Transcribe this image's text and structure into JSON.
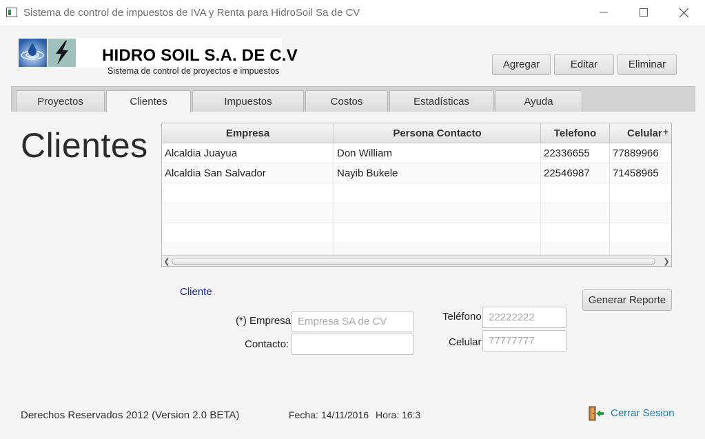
{
  "window": {
    "title": "Sistema de control de impuestos de IVA y Renta para HidroSoil Sa de CV",
    "minimize_icon": "minimize-icon",
    "maximize_icon": "maximize-icon",
    "close_icon": "close-icon"
  },
  "header": {
    "company_name": "HIDRO SOIL S.A. DE C.V",
    "subtitle": "Sistema de control de proyectos e impuestos",
    "actions": {
      "add_label": "Agregar",
      "edit_label": "Editar",
      "delete_label": "Eliminar"
    }
  },
  "tabs": [
    {
      "label": "Proyectos"
    },
    {
      "label": "Clientes"
    },
    {
      "label": "Impuestos"
    },
    {
      "label": "Costos"
    },
    {
      "label": "Estadísticas"
    },
    {
      "label": "Ayuda"
    }
  ],
  "active_tab": "Clientes",
  "page_title": "Clientes",
  "table": {
    "columns": [
      "Empresa",
      "Persona Contacto",
      "Telefono",
      "Celular"
    ],
    "rows": [
      [
        "Alcaldia Juayua",
        "Don William",
        "22336655",
        "77889966"
      ],
      [
        "Alcaldia San Salvador",
        "Nayib Bukele",
        "22546987",
        "71458965"
      ]
    ],
    "column_menu_icon": "plus-icon"
  },
  "form": {
    "section_title": "Cliente",
    "empresa_label": "(*) Empresa:",
    "empresa_placeholder": "Empresa SA de CV",
    "contacto_label": "Contacto:",
    "contacto_value": "",
    "telefono_label": "Teléfono:",
    "telefono_placeholder": "22222222",
    "celular_label": "Celular:",
    "celular_placeholder": "77777777",
    "report_button": "Generar Reporte"
  },
  "footer": {
    "copyright": "Derechos Reservados 2012 (Version 2.0 BETA)",
    "fecha_label": "Fecha:",
    "fecha_value": "14/11/2016",
    "hora_label": "Hora:",
    "hora_value": "16:3",
    "logout_label": "Cerrar Sesion",
    "logout_icon": "exit-door-icon"
  },
  "colors": {
    "accent_link": "#1f7aa8",
    "section_title": "#1a2a8a",
    "logout_arrow": "#2e9a3c"
  }
}
